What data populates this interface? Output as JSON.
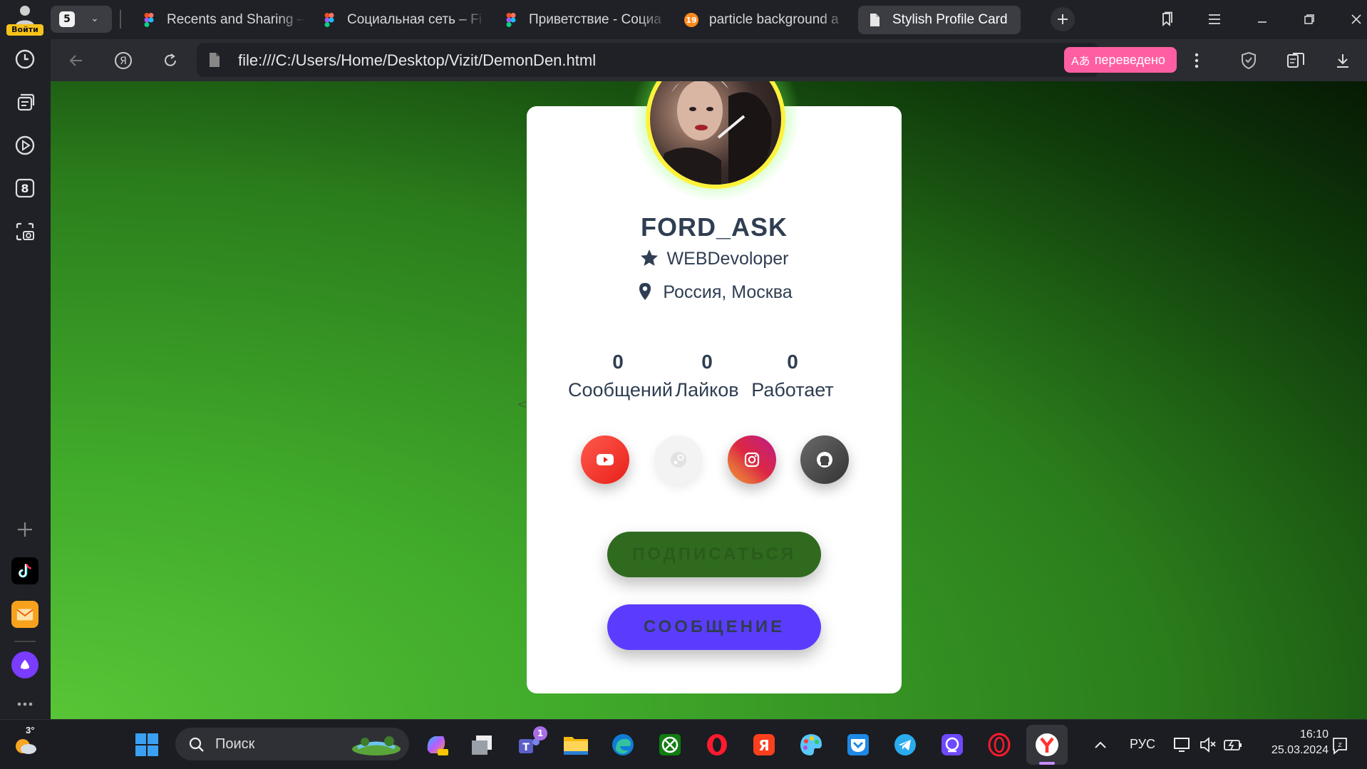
{
  "sidebar": {
    "login_label": "Войти",
    "items": [
      {
        "icon": "history-clock-icon"
      },
      {
        "icon": "collections-icon"
      },
      {
        "icon": "video-play-icon"
      },
      {
        "icon": "zen-8-icon",
        "badge": "8"
      },
      {
        "icon": "screenshot-camera-icon"
      }
    ],
    "add_icon": "plus-icon",
    "apps": [
      {
        "icon": "tiktok-icon"
      },
      {
        "icon": "mail-icon"
      },
      {
        "icon": "alice-icon"
      }
    ],
    "more_icon": "more-dots-icon"
  },
  "tabs": {
    "count": "5",
    "items": [
      {
        "title": "Recents and Sharing –",
        "icon": "figma-icon",
        "active": false
      },
      {
        "title": "Социальная сеть – Fi",
        "icon": "figma-icon",
        "active": false
      },
      {
        "title": "Приветствие - Социа",
        "icon": "figma-icon",
        "active": false
      },
      {
        "title": "particle background a",
        "icon": "orange-site-icon",
        "active": false
      },
      {
        "title": "Stylish Profile Card",
        "icon": "page-icon",
        "active": true
      }
    ]
  },
  "address_bar": {
    "url": "file:///C:/Users/Home/Desktop/Vizit/DemonDen.html",
    "translated_label": "переведено"
  },
  "profile": {
    "name": "FORD_ASK",
    "role": "WEBDevoloper",
    "location": "Россия, Москва",
    "stats": [
      {
        "value": "0",
        "label": "Сообщений"
      },
      {
        "value": "0",
        "label": "Лайков"
      },
      {
        "value": "0",
        "label": "Работает"
      }
    ],
    "socials": [
      {
        "name": "youtube",
        "icon": "youtube-icon",
        "color": "#f02b2b"
      },
      {
        "name": "steam",
        "icon": "steam-icon",
        "color": "#f2f2f2"
      },
      {
        "name": "instagram",
        "icon": "instagram-icon",
        "color": "#e1306c"
      },
      {
        "name": "github",
        "icon": "github-icon",
        "color": "#444444"
      }
    ],
    "subscribe_label": "ПОДПИСАТЬСЯ",
    "message_label": "СООБЩЕНИЕ",
    "colors": {
      "subscribe_bg": "#2f6a1f",
      "subscribe_text": "#2a5a1c",
      "message_bg": "#5b3cff",
      "message_text": "#2f3e52",
      "avatar_ring": "#fff23a",
      "text": "#2f3e52"
    }
  },
  "taskbar": {
    "weather": "3°",
    "search_placeholder": "Поиск",
    "teams_badge": "1",
    "lang": "РУС",
    "time": "16:10",
    "date": "25.03.2024"
  }
}
